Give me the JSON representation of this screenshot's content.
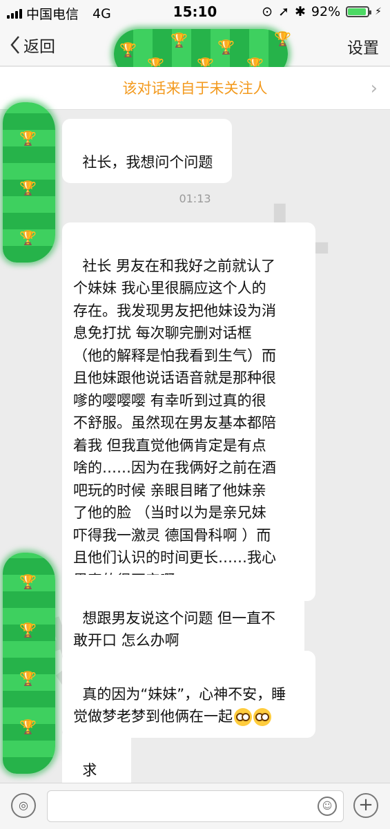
{
  "status_bar": {
    "carrier": "中国电信",
    "network": "4G",
    "time": "15:10",
    "battery": "92%",
    "battery_level": 0.92
  },
  "nav": {
    "back_label": "返回",
    "settings_label": "设置"
  },
  "notice": {
    "text": "该对话来自于未关注人"
  },
  "chat": {
    "timestamp": "01:13",
    "messages": [
      {
        "text": "社长，我想问个问题"
      },
      {
        "text": "社长 男友在和我好之前就认了\n个妹妹 我心里很膈应这个人的\n存在。我发现男友把他妹设为消\n息免打扰 每次聊完删对话框\n（他的解释是怕我看到生气）而\n且他妹跟他说话语音就是那种很\n嗲的嘤嘤嘤 有幸听到过真的很\n不舒服。虽然现在男友基本都陪\n着我 但我直觉他俩肯定是有点\n啥的……因为在我俩好之前在酒\n吧玩的时候 亲眼目睹了他妹亲\n了他的脸 （当时以为是亲兄妹\n吓得我一激灵 德国骨科啊 ）而\n且他们认识的时间更长……我心\n里真的很不安啊"
      },
      {
        "text": "想跟男友说这个问题 但一直不\n敢开口 怎么办啊"
      },
      {
        "text": "真的因为“妹妹”，心神不安，睡\n觉做梦老梦到他俩在一起"
      },
      {
        "text": "求翻！"
      }
    ]
  },
  "input": {
    "voice_icon": "voice-icon",
    "emoji_icon": "emoji-icon",
    "plus_icon": "plus-icon"
  },
  "colors": {
    "notice_text": "#f39a1e",
    "redaction_green": "#26b34a",
    "bubble_bg": "#ffffff",
    "chat_bg": "#ececec"
  }
}
